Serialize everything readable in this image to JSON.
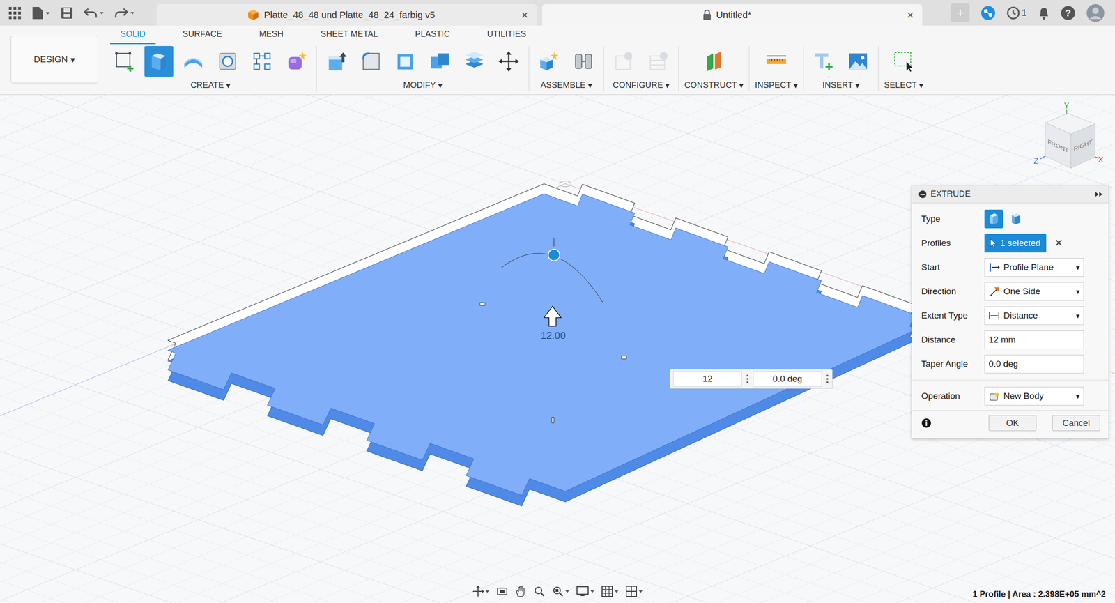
{
  "app_bar": {
    "document_tabs": [
      {
        "label": "Platte_48_48 und Platte_48_24_farbig v5",
        "selected": false,
        "close": "×"
      },
      {
        "label": "Untitled*",
        "selected": true,
        "close": "×"
      }
    ],
    "new_tab": "+",
    "jobs_count": "1",
    "help": "?"
  },
  "workspace_switcher": {
    "label": "DESIGN",
    "caret": "▾"
  },
  "toolbar_tabs": [
    {
      "label": "SOLID",
      "selected": true
    },
    {
      "label": "SURFACE",
      "selected": false
    },
    {
      "label": "MESH",
      "selected": false
    },
    {
      "label": "SHEET METAL",
      "selected": false
    },
    {
      "label": "PLASTIC",
      "selected": false
    },
    {
      "label": "UTILITIES",
      "selected": false
    }
  ],
  "tool_groups": [
    {
      "label": "CREATE",
      "caret": "▾",
      "disabled": false,
      "tools": [
        {
          "selected": false
        },
        {
          "selected": true
        },
        {
          "selected": false
        },
        {
          "selected": false
        },
        {
          "selected": false
        },
        {
          "selected": false
        }
      ]
    },
    {
      "label": "MODIFY",
      "caret": "▾",
      "disabled": false,
      "tools": [
        {
          "selected": false
        },
        {
          "selected": false
        },
        {
          "selected": false
        },
        {
          "selected": false
        },
        {
          "selected": false
        },
        {
          "selected": false
        }
      ]
    },
    {
      "label": "ASSEMBLE",
      "caret": "▾",
      "disabled": false,
      "tools": [
        {
          "selected": false
        },
        {
          "selected": false
        }
      ]
    },
    {
      "label": "CONFIGURE",
      "caret": "▾",
      "disabled": true,
      "tools": [
        {
          "selected": false
        },
        {
          "selected": false
        }
      ]
    },
    {
      "label": "CONSTRUCT",
      "caret": "▾",
      "disabled": false,
      "tools": [
        {
          "selected": false
        }
      ]
    },
    {
      "label": "INSPECT",
      "caret": "▾",
      "disabled": false,
      "tools": [
        {
          "selected": false
        }
      ]
    },
    {
      "label": "INSERT",
      "caret": "▾",
      "disabled": false,
      "tools": [
        {
          "selected": false
        },
        {
          "selected": false
        }
      ]
    },
    {
      "label": "SELECT",
      "caret": "▾",
      "disabled": false,
      "tools": [
        {
          "selected": false
        }
      ]
    }
  ],
  "canvas": {
    "dimension_label": "12.00",
    "inline_inputs": [
      {
        "value": "12"
      },
      {
        "value": "0.0 deg"
      }
    ],
    "view_cube": {
      "faces": [
        "FRONT",
        "RIGHT"
      ],
      "axes": [
        "Y",
        "Z",
        "X"
      ]
    }
  },
  "extrude_panel": {
    "title": "EXTRUDE",
    "sections": [
      [
        {
          "kind": "type",
          "label": "Type",
          "options": [
            {
              "selected": true
            },
            {
              "selected": false
            }
          ]
        },
        {
          "kind": "selection",
          "label": "Profiles",
          "value": "1 selected",
          "clear": "✕"
        },
        {
          "kind": "dropdown",
          "label": "Start",
          "value": "Profile Plane",
          "caret": "▾"
        },
        {
          "kind": "dropdown",
          "label": "Direction",
          "value": "One Side",
          "caret": "▾"
        },
        {
          "kind": "dropdown",
          "label": "Extent Type",
          "value": "Distance",
          "caret": "▾"
        },
        {
          "kind": "input",
          "label": "Distance",
          "value": "12 mm"
        },
        {
          "kind": "input",
          "label": "Taper Angle",
          "value": "0.0 deg"
        }
      ],
      [
        {
          "kind": "dropdown",
          "label": "Operation",
          "value": "New Body",
          "caret": "▾"
        }
      ]
    ],
    "buttons": [
      {
        "label": "OK"
      },
      {
        "label": "Cancel"
      }
    ]
  },
  "status_bar": {
    "text": "1 Profile | Area : 2.398E+05 mm^2"
  }
}
